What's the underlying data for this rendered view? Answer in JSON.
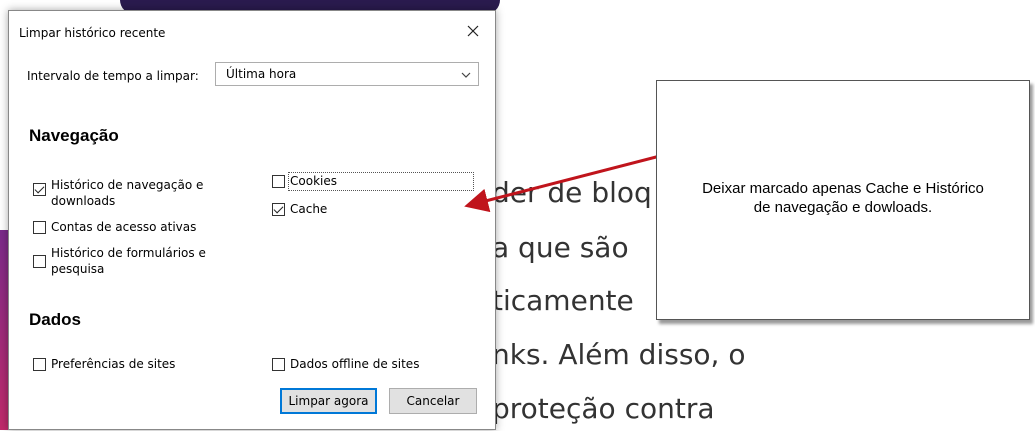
{
  "background": {
    "lines": [
      "der de bloq",
      "a que são",
      "ticamente",
      "nks. Além disso, o",
      "proteção contra"
    ]
  },
  "dialog": {
    "title": "Limpar histórico recente",
    "time_range_label": "Intervalo de tempo a limpar:",
    "time_range_value": "Última hora",
    "navigation_title": "Navegação",
    "navigation_items": [
      {
        "label_line1": "Histórico de navegação e",
        "label_line2": "downloads",
        "checked": true
      },
      {
        "label_line1": "Contas de acesso ativas",
        "checked": false
      },
      {
        "label_line1": "Histórico de formulários e",
        "label_line2": "pesquisa",
        "checked": false
      },
      {
        "label_line1": "Cookies",
        "checked": false
      },
      {
        "label_line1": "Cache",
        "checked": true
      }
    ],
    "data_title": "Dados",
    "data_items": [
      {
        "label": "Preferências de sites",
        "checked": false
      },
      {
        "label": "Dados offline de sites",
        "checked": false
      }
    ],
    "clear_button": "Limpar agora",
    "cancel_button": "Cancelar"
  },
  "callout": {
    "line1": "Deixar marcado apenas Cache e Histórico",
    "line2": "de navegação e dowloads."
  },
  "colors": {
    "arrow": "#c0141c",
    "accent": "#0078d7"
  }
}
